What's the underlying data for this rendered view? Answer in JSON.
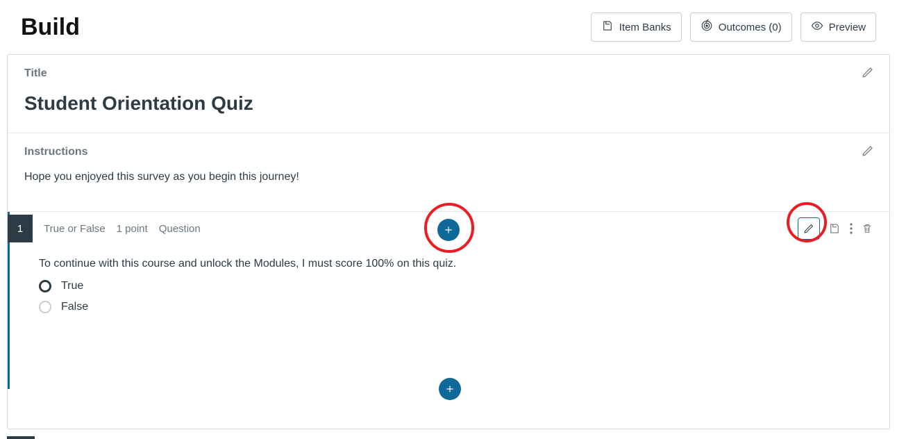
{
  "header": {
    "heading": "Build",
    "buttons": {
      "item_banks": "Item Banks",
      "outcomes": "Outcomes (0)",
      "preview": "Preview"
    }
  },
  "title_section": {
    "label": "Title",
    "value": "Student Orientation Quiz"
  },
  "instructions_section": {
    "label": "Instructions",
    "text": "Hope you enjoyed this survey as you begin this journey!"
  },
  "question": {
    "number": "1",
    "type_label": "True or False",
    "points_label": "1 point",
    "kind_label": "Question",
    "prompt": "To continue with this course and unlock the Modules, I must score 100% on this quiz.",
    "choices": [
      {
        "label": "True",
        "selected": true
      },
      {
        "label": "False",
        "selected": false
      }
    ]
  },
  "colors": {
    "accent": "#0e6898",
    "ring": "#ec1c24",
    "text": "#2d3b45",
    "muted": "#6b7780"
  }
}
